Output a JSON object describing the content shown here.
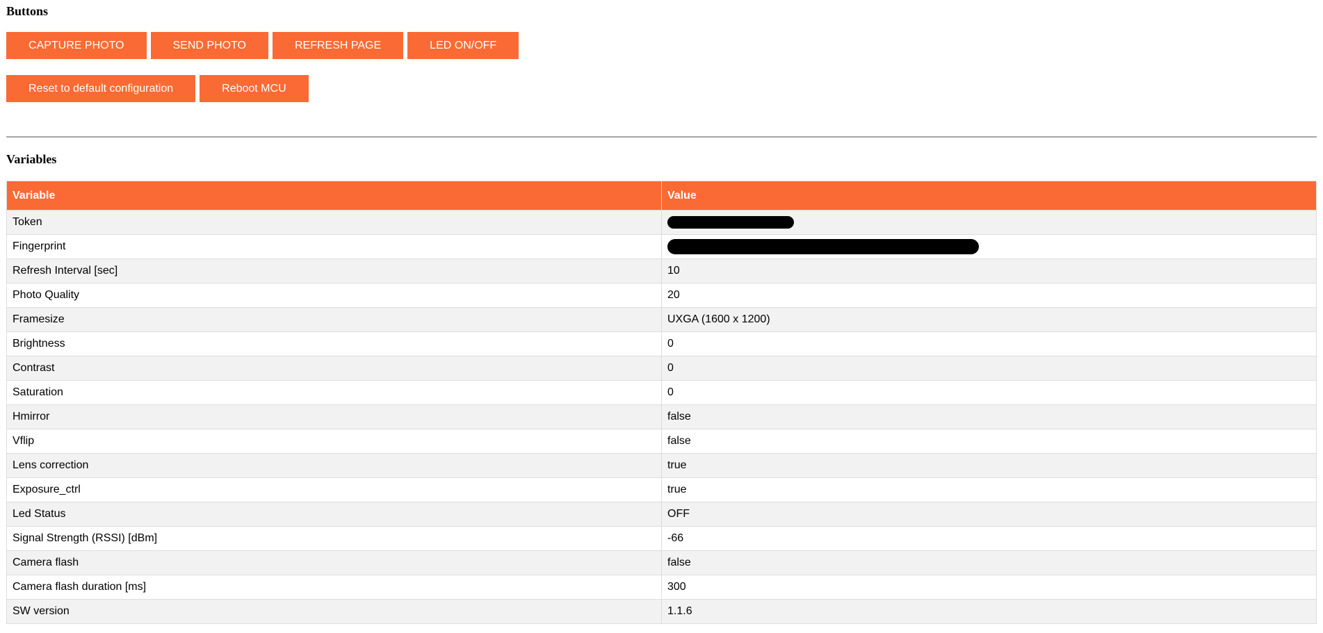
{
  "buttons_section": {
    "title": "Buttons",
    "row1": [
      {
        "label": "CAPTURE PHOTO"
      },
      {
        "label": "SEND PHOTO"
      },
      {
        "label": "REFRESH PAGE"
      },
      {
        "label": "LED ON/OFF"
      }
    ],
    "row2": [
      {
        "label": "Reset to default configuration"
      },
      {
        "label": "Reboot MCU"
      }
    ],
    "button_color": "#fa6a34"
  },
  "variables_section": {
    "title": "Variables",
    "headers": {
      "variable": "Variable",
      "value": "Value"
    },
    "rows": [
      {
        "variable": "Token",
        "value": "",
        "redacted": true
      },
      {
        "variable": "Fingerprint",
        "value": "",
        "redacted": true
      },
      {
        "variable": "Refresh Interval [sec]",
        "value": "10"
      },
      {
        "variable": "Photo Quality",
        "value": "20"
      },
      {
        "variable": "Framesize",
        "value": "UXGA (1600 x 1200)"
      },
      {
        "variable": "Brightness",
        "value": "0"
      },
      {
        "variable": "Contrast",
        "value": "0"
      },
      {
        "variable": "Saturation",
        "value": "0"
      },
      {
        "variable": "Hmirror",
        "value": "false"
      },
      {
        "variable": "Vflip",
        "value": "false"
      },
      {
        "variable": "Lens correction",
        "value": "true"
      },
      {
        "variable": "Exposure_ctrl",
        "value": "true"
      },
      {
        "variable": "Led Status",
        "value": "OFF"
      },
      {
        "variable": "Signal Strength (RSSI) [dBm]",
        "value": "-66"
      },
      {
        "variable": "Camera flash",
        "value": "false"
      },
      {
        "variable": "Camera flash duration [ms]",
        "value": "300"
      },
      {
        "variable": "SW version",
        "value": "1.1.6"
      }
    ],
    "header_color": "#fa6a34"
  }
}
